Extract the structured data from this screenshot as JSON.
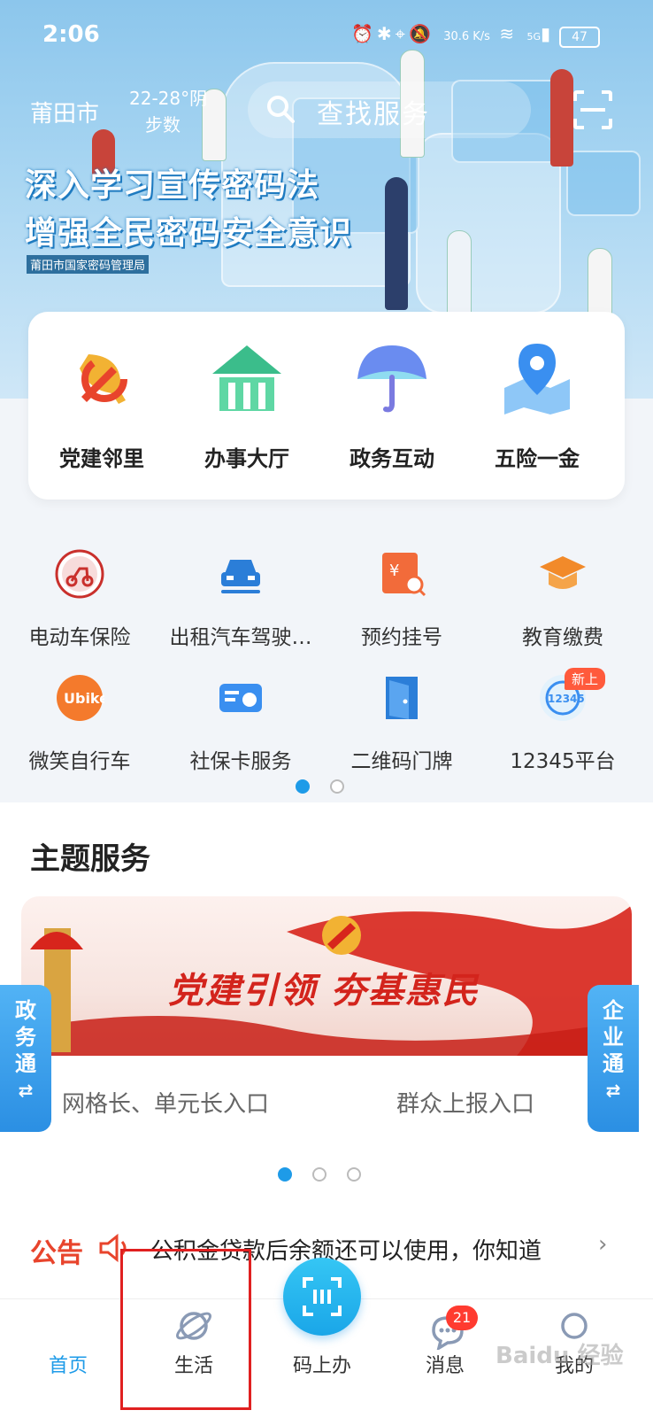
{
  "status_bar": {
    "time": "2:06",
    "net_speed": "30.6 K/s",
    "network": "5G",
    "battery": "47"
  },
  "header": {
    "city": "莆田市",
    "weather_temp": "22-28°阴",
    "weather_steps": "步数",
    "search_placeholder": "查找服务",
    "banner_line1": "深入学习宣传密码法",
    "banner_line2": "增强全民密码安全意识",
    "banner_org": "莆田市国家密码管理局"
  },
  "quick_services": [
    {
      "label": "党建邻里",
      "icon": "party-emblem-icon",
      "color": "#e8442c"
    },
    {
      "label": "办事大厅",
      "icon": "hall-icon",
      "color": "#3bbd8b"
    },
    {
      "label": "政务互动",
      "icon": "umbrella-icon",
      "color": "#5a7de8"
    },
    {
      "label": "五险一金",
      "icon": "map-pin-icon",
      "color": "#3a8ff0"
    }
  ],
  "grid_services": [
    {
      "label": "电动车保险",
      "icon": "ebike-insurance-icon"
    },
    {
      "label": "出租汽车驾驶…",
      "icon": "taxi-icon"
    },
    {
      "label": "预约挂号",
      "icon": "registration-icon"
    },
    {
      "label": "教育缴费",
      "icon": "graduation-cap-icon"
    },
    {
      "label": "微笑自行车",
      "icon": "ubike-icon"
    },
    {
      "label": "社保卡服务",
      "icon": "social-card-icon"
    },
    {
      "label": "二维码门牌",
      "icon": "door-icon"
    },
    {
      "label": "12345平台",
      "icon": "hotline-12345-icon"
    }
  ],
  "new_badge": "新上",
  "theme": {
    "title": "主题服务",
    "banner_text": "党建引领  夯基惠民",
    "entry_left": "网格长、单元长入口",
    "entry_right": "群众上报入口",
    "side_left": "政务通",
    "side_right": "企业通"
  },
  "notice": {
    "label": "公告",
    "text": "公积金贷款后余额还可以使用，你知道"
  },
  "bottom_nav": {
    "home": "首页",
    "life": "生活",
    "code": "码上办",
    "messages": "消息",
    "messages_count": "21",
    "mine": "我的"
  },
  "colors": {
    "accent": "#1e9be8",
    "notice_red": "#e8442c",
    "highlight_box": "#e02020"
  }
}
